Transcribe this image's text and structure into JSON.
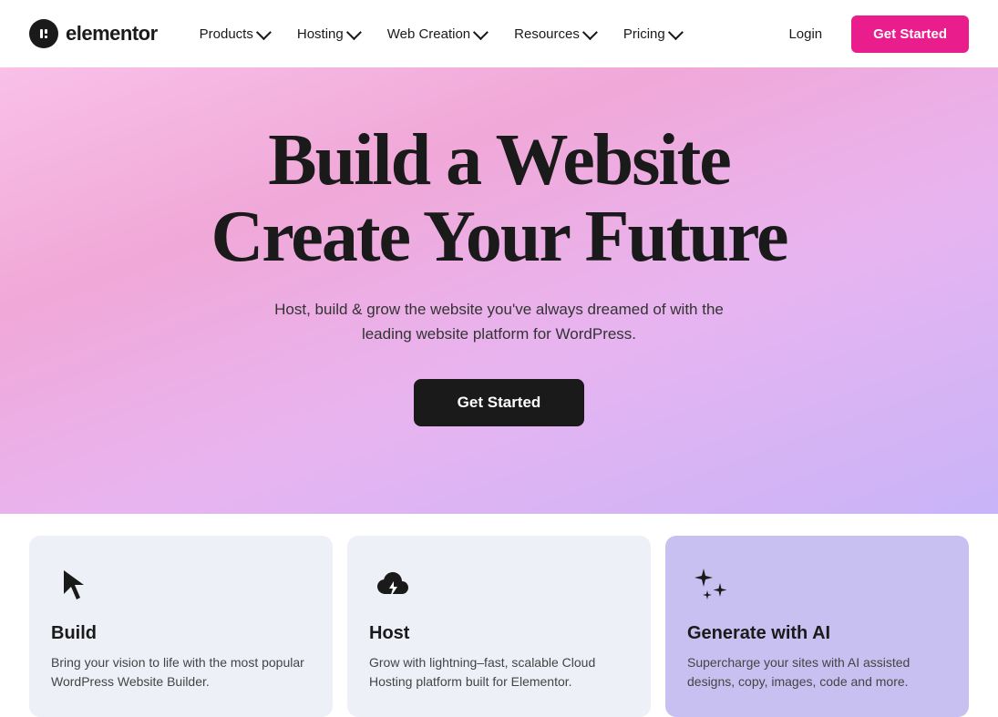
{
  "logo": {
    "icon_text": "e",
    "text": "elementor"
  },
  "nav": {
    "items": [
      {
        "label": "Products",
        "has_dropdown": true
      },
      {
        "label": "Hosting",
        "has_dropdown": true
      },
      {
        "label": "Web Creation",
        "has_dropdown": true
      },
      {
        "label": "Resources",
        "has_dropdown": true
      },
      {
        "label": "Pricing",
        "has_dropdown": true
      }
    ],
    "login_label": "Login",
    "get_started_label": "Get Started"
  },
  "hero": {
    "title_line1": "Build a Website",
    "title_line2": "Create Your Future",
    "subtitle": "Host, build & grow the website you've always dreamed of with the leading website platform for WordPress.",
    "cta_label": "Get Started"
  },
  "cards": [
    {
      "id": "build",
      "title": "Build",
      "description": "Bring your vision to life with the most popular WordPress Website Builder.",
      "icon": "cursor-icon",
      "bg": "light"
    },
    {
      "id": "host",
      "title": "Host",
      "description": "Grow with lightning–fast, scalable Cloud Hosting platform built for Elementor.",
      "icon": "cloud-icon",
      "bg": "light"
    },
    {
      "id": "ai",
      "title": "Generate with AI",
      "description": "Supercharge your sites with AI assisted designs, copy, images, code and more.",
      "icon": "ai-stars-icon",
      "bg": "purple"
    }
  ]
}
